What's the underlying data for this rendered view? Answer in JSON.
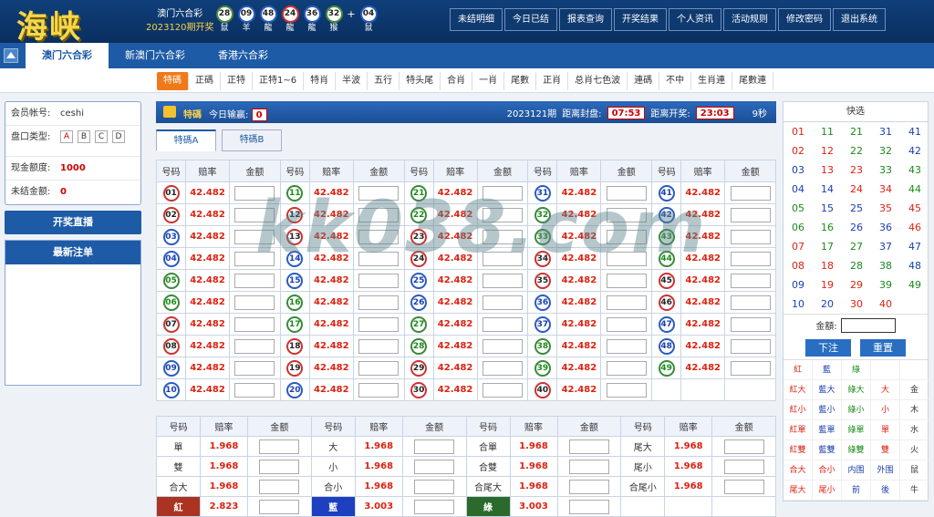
{
  "logo": "海峡",
  "draw": {
    "lottery": "澳门六合彩",
    "period": "2023120期开奖"
  },
  "balls": [
    {
      "n": "28",
      "z": "鼠",
      "c": "green"
    },
    {
      "n": "09",
      "z": "羊",
      "c": "blue"
    },
    {
      "n": "48",
      "z": "龍",
      "c": "blue"
    },
    {
      "n": "24",
      "z": "龍",
      "c": "red"
    },
    {
      "n": "36",
      "z": "龍",
      "c": "blue"
    },
    {
      "n": "32",
      "z": "猴",
      "c": "green"
    },
    {
      "n": "04",
      "z": "鼠",
      "c": "blue"
    }
  ],
  "plus": "+",
  "nav": [
    "未结明细",
    "今日已结",
    "报表查询",
    "开奖结果",
    "个人资讯",
    "活动规则",
    "修改密码",
    "退出系统"
  ],
  "tabs": [
    "澳门六合彩",
    "新澳门六合彩",
    "香港六合彩"
  ],
  "subnav": [
    "特碼",
    "正碼",
    "正特",
    "正特1~6",
    "特肖",
    "半波",
    "五行",
    "特头尾",
    "合肖",
    "一肖",
    "尾數",
    "正肖",
    "总肖七色波",
    "連碼",
    "不中",
    "生肖連",
    "尾數連"
  ],
  "account": {
    "rows": [
      {
        "k": "会员帐号:",
        "v": "ceshi"
      },
      {
        "k": "盘口类型:",
        "v": ""
      },
      {
        "k": "现金额度:",
        "v": "1000"
      },
      {
        "k": "未结金额:",
        "v": "0"
      }
    ],
    "abc": [
      "A",
      "B",
      "C",
      "D"
    ]
  },
  "live_btn": "开奖直播",
  "latest_title": "最新注单",
  "header": {
    "type": "特碼",
    "today_label": "今日输赢:",
    "today_val": "0",
    "period": "2023121期",
    "close_label": "距离封盘:",
    "close_val": "07:53",
    "open_label": "距离开奖:",
    "open_val": "23:03",
    "secs": "9秒"
  },
  "subtabs": [
    "特碼A",
    "特碼B"
  ],
  "grid_headers": [
    "号码",
    "赔率",
    "金额"
  ],
  "odds": "42.482",
  "grid_rows": [
    [
      "01",
      "11",
      "21",
      "31",
      "41"
    ],
    [
      "02",
      "12",
      "22",
      "32",
      "42"
    ],
    [
      "03",
      "13",
      "23",
      "33",
      "43"
    ],
    [
      "04",
      "14",
      "24",
      "34",
      "44"
    ],
    [
      "05",
      "15",
      "25",
      "35",
      "45"
    ],
    [
      "06",
      "16",
      "26",
      "36",
      "46"
    ],
    [
      "07",
      "17",
      "27",
      "37",
      "47"
    ],
    [
      "08",
      "18",
      "28",
      "38",
      "48"
    ],
    [
      "09",
      "19",
      "29",
      "39",
      "49"
    ],
    [
      "10",
      "20",
      "30",
      "40",
      ""
    ]
  ],
  "grid_colors": {
    "01": "red",
    "02": "red",
    "03": "blue",
    "04": "blue",
    "05": "green",
    "06": "green",
    "07": "red",
    "08": "red",
    "09": "blue",
    "10": "blue",
    "11": "green",
    "12": "red",
    "13": "red",
    "14": "blue",
    "15": "blue",
    "16": "green",
    "17": "green",
    "18": "red",
    "19": "red",
    "20": "blue",
    "21": "green",
    "22": "green",
    "23": "red",
    "24": "red",
    "25": "blue",
    "26": "blue",
    "27": "green",
    "28": "green",
    "29": "red",
    "30": "red",
    "31": "blue",
    "32": "green",
    "33": "green",
    "34": "red",
    "35": "red",
    "36": "blue",
    "37": "blue",
    "38": "green",
    "39": "green",
    "40": "red",
    "41": "blue",
    "42": "blue",
    "43": "green",
    "44": "green",
    "45": "red",
    "46": "red",
    "47": "blue",
    "48": "blue",
    "49": "green"
  },
  "grid2_rows": [
    [
      {
        "l": "單",
        "o": "1.968"
      },
      {
        "l": "大",
        "o": "1.968"
      },
      {
        "l": "合單",
        "o": "1.968"
      },
      {
        "l": "尾大",
        "o": "1.968"
      }
    ],
    [
      {
        "l": "雙",
        "o": "1.968"
      },
      {
        "l": "小",
        "o": "1.968"
      },
      {
        "l": "合雙",
        "o": "1.968"
      },
      {
        "l": "尾小",
        "o": "1.968"
      }
    ],
    [
      {
        "l": "合大",
        "o": "1.968"
      },
      {
        "l": "合小",
        "o": "1.968"
      },
      {
        "l": "合尾大",
        "o": "1.968"
      },
      {
        "l": "合尾小",
        "o": "1.968"
      }
    ],
    [
      {
        "l": "紅",
        "o": "2.823",
        "c": "red"
      },
      {
        "l": "藍",
        "o": "3.003",
        "c": "blue"
      },
      {
        "l": "綠",
        "o": "3.003",
        "c": "green"
      },
      {
        "l": "",
        "o": ""
      }
    ]
  ],
  "quick": {
    "title": "快选",
    "nums": [
      [
        "01",
        "11",
        "21",
        "31",
        "41"
      ],
      [
        "02",
        "12",
        "22",
        "32",
        "42"
      ],
      [
        "03",
        "13",
        "23",
        "33",
        "43"
      ],
      [
        "04",
        "14",
        "24",
        "34",
        "44"
      ],
      [
        "05",
        "15",
        "25",
        "35",
        "45"
      ],
      [
        "06",
        "16",
        "26",
        "36",
        "46"
      ],
      [
        "07",
        "17",
        "27",
        "37",
        "47"
      ],
      [
        "08",
        "18",
        "28",
        "38",
        "48"
      ],
      [
        "09",
        "19",
        "29",
        "39",
        "49"
      ],
      [
        "10",
        "20",
        "30",
        "40",
        ""
      ]
    ],
    "amount_label": "金額:",
    "submit": "下注",
    "reset": "重置",
    "zodiac": [
      [
        {
          "t": "紅",
          "c": "red"
        },
        {
          "t": "藍",
          "c": "blue"
        },
        {
          "t": "綠",
          "c": "green"
        },
        {
          "t": "",
          "c": "dark"
        },
        {
          "t": "",
          "c": "dark"
        }
      ],
      [
        {
          "t": "紅大",
          "c": "red"
        },
        {
          "t": "藍大",
          "c": "blue"
        },
        {
          "t": "綠大",
          "c": "green"
        },
        {
          "t": "大",
          "c": "red"
        },
        {
          "t": "金",
          "c": "dark"
        }
      ],
      [
        {
          "t": "紅小",
          "c": "red"
        },
        {
          "t": "藍小",
          "c": "blue"
        },
        {
          "t": "綠小",
          "c": "green"
        },
        {
          "t": "小",
          "c": "red"
        },
        {
          "t": "木",
          "c": "dark"
        }
      ],
      [
        {
          "t": "紅單",
          "c": "red"
        },
        {
          "t": "藍單",
          "c": "blue"
        },
        {
          "t": "綠單",
          "c": "green"
        },
        {
          "t": "單",
          "c": "red"
        },
        {
          "t": "水",
          "c": "dark"
        }
      ],
      [
        {
          "t": "紅雙",
          "c": "red"
        },
        {
          "t": "藍雙",
          "c": "blue"
        },
        {
          "t": "綠雙",
          "c": "green"
        },
        {
          "t": "雙",
          "c": "red"
        },
        {
          "t": "火",
          "c": "dark"
        }
      ],
      [
        {
          "t": "合大",
          "c": "red"
        },
        {
          "t": "合小",
          "c": "red"
        },
        {
          "t": "内围",
          "c": "blue"
        },
        {
          "t": "外围",
          "c": "blue"
        },
        {
          "t": "鼠",
          "c": "dark"
        }
      ],
      [
        {
          "t": "尾大",
          "c": "red"
        },
        {
          "t": "尾小",
          "c": "red"
        },
        {
          "t": "前",
          "c": "blue"
        },
        {
          "t": "後",
          "c": "blue"
        },
        {
          "t": "牛",
          "c": "dark"
        }
      ]
    ]
  },
  "watermark": "kk038.com",
  "colors": {
    "red": "#d21",
    "blue": "#1a3fb0",
    "green": "#1a8a1a",
    "accent": "#1e5ba6",
    "orange": "#f07a1a"
  }
}
